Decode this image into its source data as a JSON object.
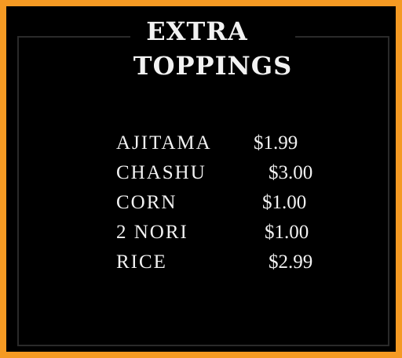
{
  "menu": {
    "title_line1": "EXTRA",
    "title_line2": "TOPPINGS",
    "items": [
      {
        "name": "AJITAMA",
        "price": "$1.99"
      },
      {
        "name": "CHASHU",
        "price": "$3.00"
      },
      {
        "name": "CORN",
        "price": "$1.00"
      },
      {
        "name": "2 NORI",
        "price": "$1.00"
      },
      {
        "name": "RICE",
        "price": "$2.99"
      }
    ]
  },
  "colors": {
    "frame": "#f59a23",
    "background": "#000000",
    "text": "#f2f2f2"
  }
}
